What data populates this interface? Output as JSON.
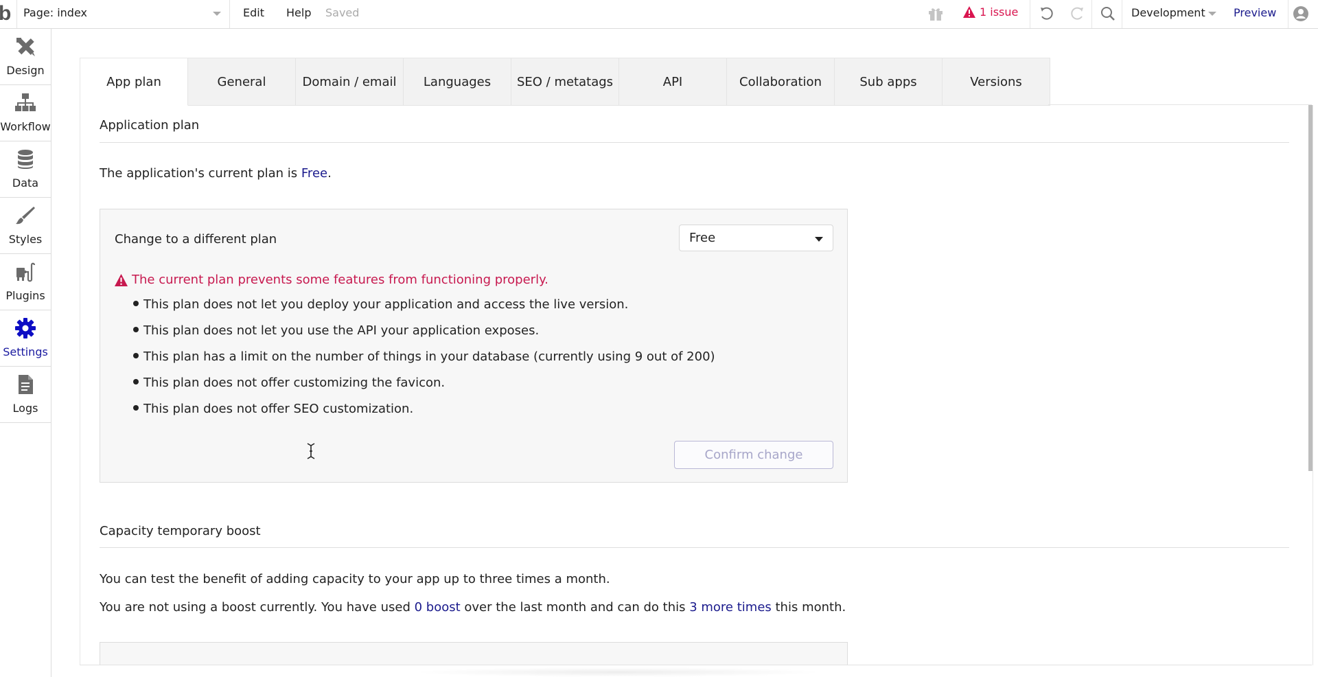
{
  "topbar": {
    "logo": "b",
    "page_selector": "Page: index",
    "menu": {
      "edit": "Edit",
      "help": "Help"
    },
    "save_status": "Saved",
    "issues": "1 issue",
    "environment": "Development",
    "preview": "Preview",
    "icons": [
      "gift-icon",
      "warning-icon",
      "undo-icon",
      "redo-icon",
      "search-icon",
      "chevron-down-icon",
      "user-avatar-icon"
    ]
  },
  "sidebar": {
    "items": [
      {
        "label": "Design",
        "icon": "design-tools-icon",
        "active": false
      },
      {
        "label": "Workflow",
        "icon": "workflow-icon",
        "active": false
      },
      {
        "label": "Data",
        "icon": "database-icon",
        "active": false
      },
      {
        "label": "Styles",
        "icon": "brush-icon",
        "active": false
      },
      {
        "label": "Plugins",
        "icon": "plug-icon",
        "active": false
      },
      {
        "label": "Settings",
        "icon": "gear-icon",
        "active": true
      },
      {
        "label": "Logs",
        "icon": "document-icon",
        "active": false
      }
    ]
  },
  "tabs": [
    {
      "label": "App plan",
      "active": true
    },
    {
      "label": "General",
      "active": false
    },
    {
      "label": "Domain / email",
      "active": false
    },
    {
      "label": "Languages",
      "active": false
    },
    {
      "label": "SEO / metatags",
      "active": false
    },
    {
      "label": "API",
      "active": false
    },
    {
      "label": "Collaboration",
      "active": false
    },
    {
      "label": "Sub apps",
      "active": false
    },
    {
      "label": "Versions",
      "active": false
    }
  ],
  "app_plan": {
    "section_title": "Application plan",
    "current_plan_prefix": "The application's current plan is ",
    "current_plan": "Free",
    "current_plan_suffix": ".",
    "change_label": "Change to a different plan",
    "plan_select_value": "Free",
    "warning": "The current plan prevents some features from functioning properly.",
    "limitations": [
      "This plan does not let you deploy your application and access the live version.",
      "This plan does not let you use the API your application exposes.",
      "This plan has a limit on the number of things in your database (currently using 9 out of 200)",
      "This plan does not offer customizing the favicon.",
      "This plan does not offer SEO customization."
    ],
    "confirm_button": "Confirm change"
  },
  "capacity_boost": {
    "section_title": "Capacity temporary boost",
    "intro": "You can test the benefit of adding capacity to your app up to three times a month.",
    "status_prefix": "You are not using a boost currently. You have used ",
    "boosts_used": "0 boost",
    "status_middle": " over the last month and can do this ",
    "remaining": "3 more times",
    "status_suffix": " this month."
  },
  "colors": {
    "accent": "#1a1a8c",
    "warning": "#c7194f",
    "issue": "#d9154f",
    "disabled_button_text": "#a7a6c9"
  }
}
